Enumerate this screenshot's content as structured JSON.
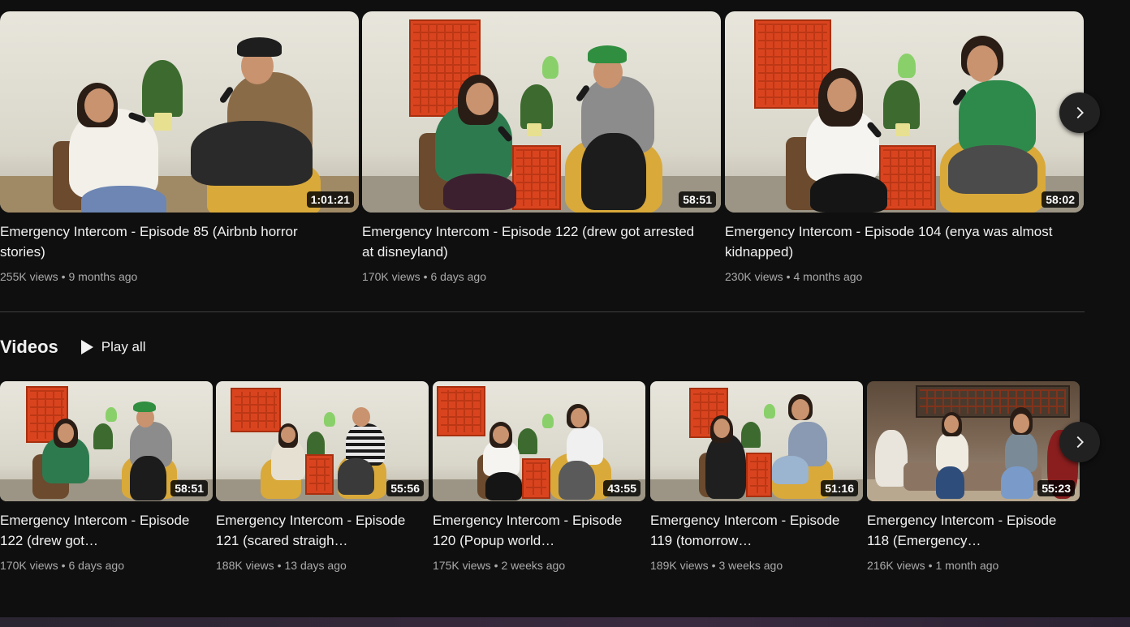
{
  "featured": [
    {
      "title": "Emergency Intercom - Episode 85 (Airbnb horror stories)",
      "views": "255K views",
      "age": "9 months ago",
      "duration": "1:01:21"
    },
    {
      "title": "Emergency Intercom - Episode 122 (drew got arrested at disneyland)",
      "views": "170K views",
      "age": "6 days ago",
      "duration": "58:51"
    },
    {
      "title": "Emergency Intercom - Episode 104 (enya was almost kidnapped)",
      "views": "230K views",
      "age": "4 months ago",
      "duration": "58:02"
    }
  ],
  "videos_section": {
    "title": "Videos",
    "play_all_label": "Play all"
  },
  "videos": [
    {
      "title": "Emergency Intercom - Episode 122 (drew got…",
      "views": "170K views",
      "age": "6 days ago",
      "duration": "58:51"
    },
    {
      "title": "Emergency Intercom - Episode 121 (scared straigh…",
      "views": "188K views",
      "age": "13 days ago",
      "duration": "55:56"
    },
    {
      "title": "Emergency Intercom - Episode 120 (Popup world…",
      "views": "175K views",
      "age": "2 weeks ago",
      "duration": "43:55"
    },
    {
      "title": "Emergency Intercom - Episode 119 (tomorrow…",
      "views": "189K views",
      "age": "3 weeks ago",
      "duration": "51:16"
    },
    {
      "title": "Emergency Intercom - Episode 118 (Emergency…",
      "views": "216K views",
      "age": "1 month ago",
      "duration": "55:23"
    }
  ],
  "meta_separator": "•",
  "icons": {
    "next": "chevron-right-icon",
    "play": "play-icon"
  },
  "colors": {
    "background": "#0f0f0f",
    "text": "#f1f1f1",
    "secondary_text": "#aaaaaa",
    "shelf_red": "#d9441f"
  }
}
